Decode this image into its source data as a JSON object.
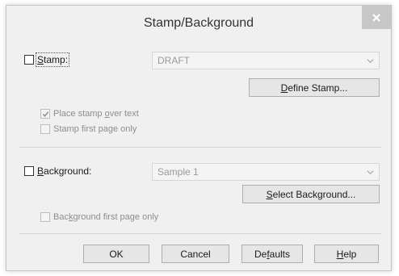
{
  "dialog": {
    "title": "Stamp/Background"
  },
  "stamp": {
    "label_pre": "",
    "label_key": "S",
    "label_post": "tamp:",
    "enabled": false,
    "selected_value": "DRAFT",
    "define_button": {
      "key": "D",
      "rest": "efine Stamp..."
    },
    "place_over_text": {
      "pre": "Place stamp ",
      "key": "o",
      "post": "ver text",
      "checked": true
    },
    "first_page_only": {
      "label": "Stamp first page only",
      "checked": false
    }
  },
  "background": {
    "label_pre": "",
    "label_key": "B",
    "label_post": "ackground:",
    "enabled": false,
    "selected_value": "Sample 1",
    "select_button": {
      "key": "S",
      "rest": "elect Background..."
    },
    "first_page_only": {
      "pre": "Bac",
      "key": "k",
      "post": "ground first page only",
      "checked": false
    }
  },
  "buttons": {
    "ok": "OK",
    "cancel": "Cancel",
    "defaults": {
      "pre": "De",
      "key": "f",
      "post": "aults"
    },
    "help": {
      "key": "H",
      "rest": "elp"
    }
  },
  "icons": {
    "close": "close-icon",
    "dropdown": "chevron-down-icon",
    "check": "checkmark-icon"
  },
  "colors": {
    "dialog_bg": "#f0f0f0",
    "close_button": "#c7c7c7",
    "disabled_text": "#9a9a9a"
  }
}
